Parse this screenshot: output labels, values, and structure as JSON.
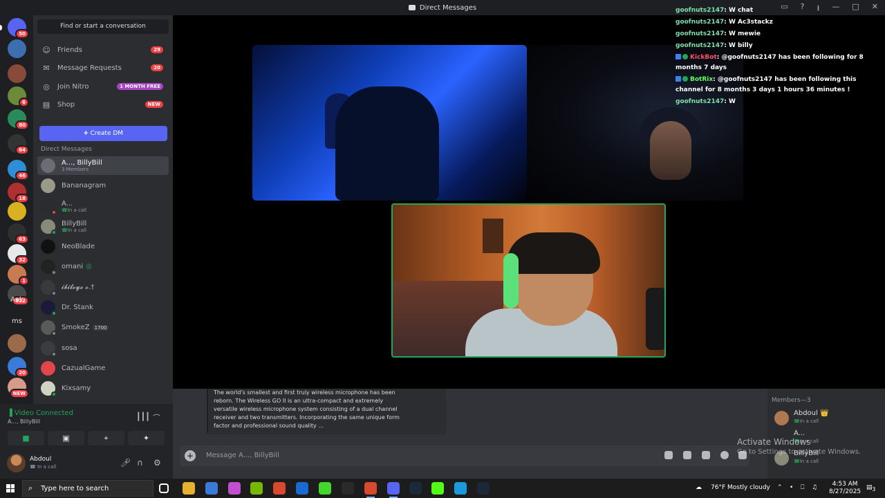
{
  "window": {
    "title": "Direct Messages",
    "controls": [
      "▭",
      "?",
      "⭳",
      "—",
      "□",
      "✕"
    ]
  },
  "servers": [
    {
      "badge": "50",
      "color": "#5865f2"
    },
    {
      "badge": "",
      "color": "#3d6fb0"
    },
    {
      "badge": "",
      "color": "#8a4a3a"
    },
    {
      "badge": "6",
      "color": "#6b8a3a"
    },
    {
      "badge": "80",
      "color": "#2b8a5a"
    },
    {
      "badge": "64",
      "color": "#333333"
    },
    {
      "badge": "46",
      "color": "#2f8ed8"
    },
    {
      "badge": "18",
      "color": "#b03030"
    },
    {
      "badge": "",
      "color": "#d8b020"
    },
    {
      "badge": "63",
      "color": "#2f2f2f"
    },
    {
      "badge": "32",
      "color": "#e8e8e8"
    },
    {
      "badge": "1",
      "color": "#c87a50"
    },
    {
      "badge": "822",
      "color": "#4a4a4a"
    },
    {
      "badge": "",
      "color": "transparent",
      "text": "Aok"
    },
    {
      "badge": "",
      "color": "transparent",
      "text": "ms"
    },
    {
      "badge": "",
      "color": "#9a6a4a"
    },
    {
      "badge": "20",
      "color": "#3a7ad8"
    },
    {
      "badge": "NEW",
      "color": "#d89a8a"
    }
  ],
  "sidebar": {
    "find": "Find or start a conversation",
    "nav": [
      {
        "label": "Friends",
        "count": "29",
        "icon": "friends-icon",
        "glyph": "☺"
      },
      {
        "label": "Message Requests",
        "count": "20",
        "icon": "mail-icon",
        "glyph": "✉"
      },
      {
        "label": "Join Nitro",
        "tag": "1 MONTH FREE",
        "tagColor": "#a844c6",
        "icon": "nitro-icon",
        "glyph": "◎"
      },
      {
        "label": "Shop",
        "tag": "NEW",
        "tagColor": "#f23f43",
        "icon": "shop-icon",
        "glyph": "▤"
      }
    ],
    "create_dm": "Create DM",
    "dm_header": "Direct Messages",
    "dms": [
      {
        "name": "A..., BillyBill",
        "sub": "3 Members",
        "call": false,
        "avatar": "#6a6e74",
        "status": ""
      },
      {
        "name": "Bananagram",
        "sub": "",
        "call": false,
        "avatar": "#9a9a8a",
        "status": ""
      },
      {
        "name": "A...",
        "sub": "In a call",
        "call": true,
        "avatar": "#2a2c30",
        "status": "#f23f43"
      },
      {
        "name": "BillyBill",
        "sub": "In a call",
        "call": true,
        "avatar": "#8a8a7a",
        "status": "#23a55a"
      },
      {
        "name": "NeoBlade",
        "sub": "",
        "call": false,
        "avatar": "#111111",
        "status": ""
      },
      {
        "name": "omani",
        "sub": "",
        "call": false,
        "avatar": "#222222",
        "status": "#80848e",
        "suffix": "◎"
      },
      {
        "name": "𝓲𝓫𝓲𝓵𝓸𝔂𝓮 𝓸.†",
        "sub": "",
        "call": false,
        "avatar": "#3a3a3a",
        "status": "#80848e"
      },
      {
        "name": "Dr. Stank",
        "sub": "",
        "call": false,
        "avatar": "#1a1a3a",
        "status": "#23a55a"
      },
      {
        "name": "SmokeZ",
        "sub": "",
        "call": false,
        "avatar": "#5a5a5a",
        "status": "#80848e",
        "badge": "1700"
      },
      {
        "name": "sosa",
        "sub": "",
        "call": false,
        "avatar": "#3a3c42",
        "status": "#80848e"
      },
      {
        "name": "CazualGame",
        "sub": "",
        "call": false,
        "avatar": "#e0464a",
        "status": ""
      },
      {
        "name": "Kixsamy",
        "sub": "",
        "call": false,
        "avatar": "#cfd4c0",
        "status": "#23a55a"
      }
    ]
  },
  "voice": {
    "title": "Video Connected",
    "sub": "A..., BillyBill"
  },
  "user": {
    "name": "Abdoul",
    "status": "☎ In a call"
  },
  "chat": [
    {
      "user": "goofnuts2147",
      "msg": ": W chat",
      "kind": "u"
    },
    {
      "user": "goofnuts2147",
      "msg": ": W Ac3stackz",
      "kind": "u"
    },
    {
      "user": "goofnuts2147",
      "msg": ": W mewie",
      "kind": "u"
    },
    {
      "user": "goofnuts2147",
      "msg": ": W billy",
      "kind": "u"
    },
    {
      "user": "KickBot",
      "msg": ": @goofnuts2147 has been following for 8 months 7 days",
      "kind": "k"
    },
    {
      "user": "BotRix",
      "msg": ": @goofnuts2147 has been following this channel for 8 months 3 days 1 hours 36 minutes !",
      "kind": "r"
    },
    {
      "user": "goofnuts2147",
      "msg": ": W",
      "kind": "u"
    }
  ],
  "embed": {
    "text": "The world's smallest and first truly wireless microphone has been reborn. The Wireless GO II is an ultra-compact and extremely versatile wireless microphone system consisting of a dual channel receiver and two transmitters. Incorporating the same unique form factor and professional sound quality ..."
  },
  "composer": {
    "placeholder": "Message A..., BillyBill"
  },
  "members": {
    "header": "Members—3",
    "list": [
      {
        "name": "Abdoul 👑",
        "sub": "In a call",
        "avatar": "#b07850"
      },
      {
        "name": "A...",
        "sub": "In a call",
        "avatar": "#2a2c30"
      },
      {
        "name": "BillyBill",
        "sub": "In a call",
        "avatar": "#8a8a7a"
      }
    ]
  },
  "watermark": {
    "line1": "Activate Windows",
    "line2": "Go to Settings to activate Windows."
  },
  "taskbar": {
    "search": "Type here to search",
    "weather": "76°F  Mostly cloudy",
    "time": "4:53 AM",
    "date": "8/27/2025",
    "notif": "3",
    "apps": [
      {
        "icon": "task-view-icon",
        "color": "#3a3a3a"
      },
      {
        "icon": "file-explorer-icon",
        "color": "#e8b030"
      },
      {
        "icon": "store-icon",
        "color": "#3a7ad8"
      },
      {
        "icon": "copilot-icon",
        "color": "#c050d0"
      },
      {
        "icon": "nvidia-icon",
        "color": "#76b900"
      },
      {
        "icon": "chrome-icon",
        "color": "#d84a30"
      },
      {
        "icon": "outlook-icon",
        "color": "#1a6ad0"
      },
      {
        "icon": "razer-icon",
        "color": "#44d62c"
      },
      {
        "icon": "obs-icon",
        "color": "#2a2a2a"
      },
      {
        "icon": "chrome-active-icon",
        "color": "#d84a30"
      },
      {
        "icon": "discord-icon",
        "color": "#5865f2"
      },
      {
        "icon": "terminal-icon",
        "color": "#1a2a3a"
      },
      {
        "icon": "kick-icon",
        "color": "#53fc18"
      },
      {
        "icon": "edge-icon",
        "color": "#1a9ad8"
      },
      {
        "icon": "steam-icon",
        "color": "#1b2838"
      }
    ]
  }
}
